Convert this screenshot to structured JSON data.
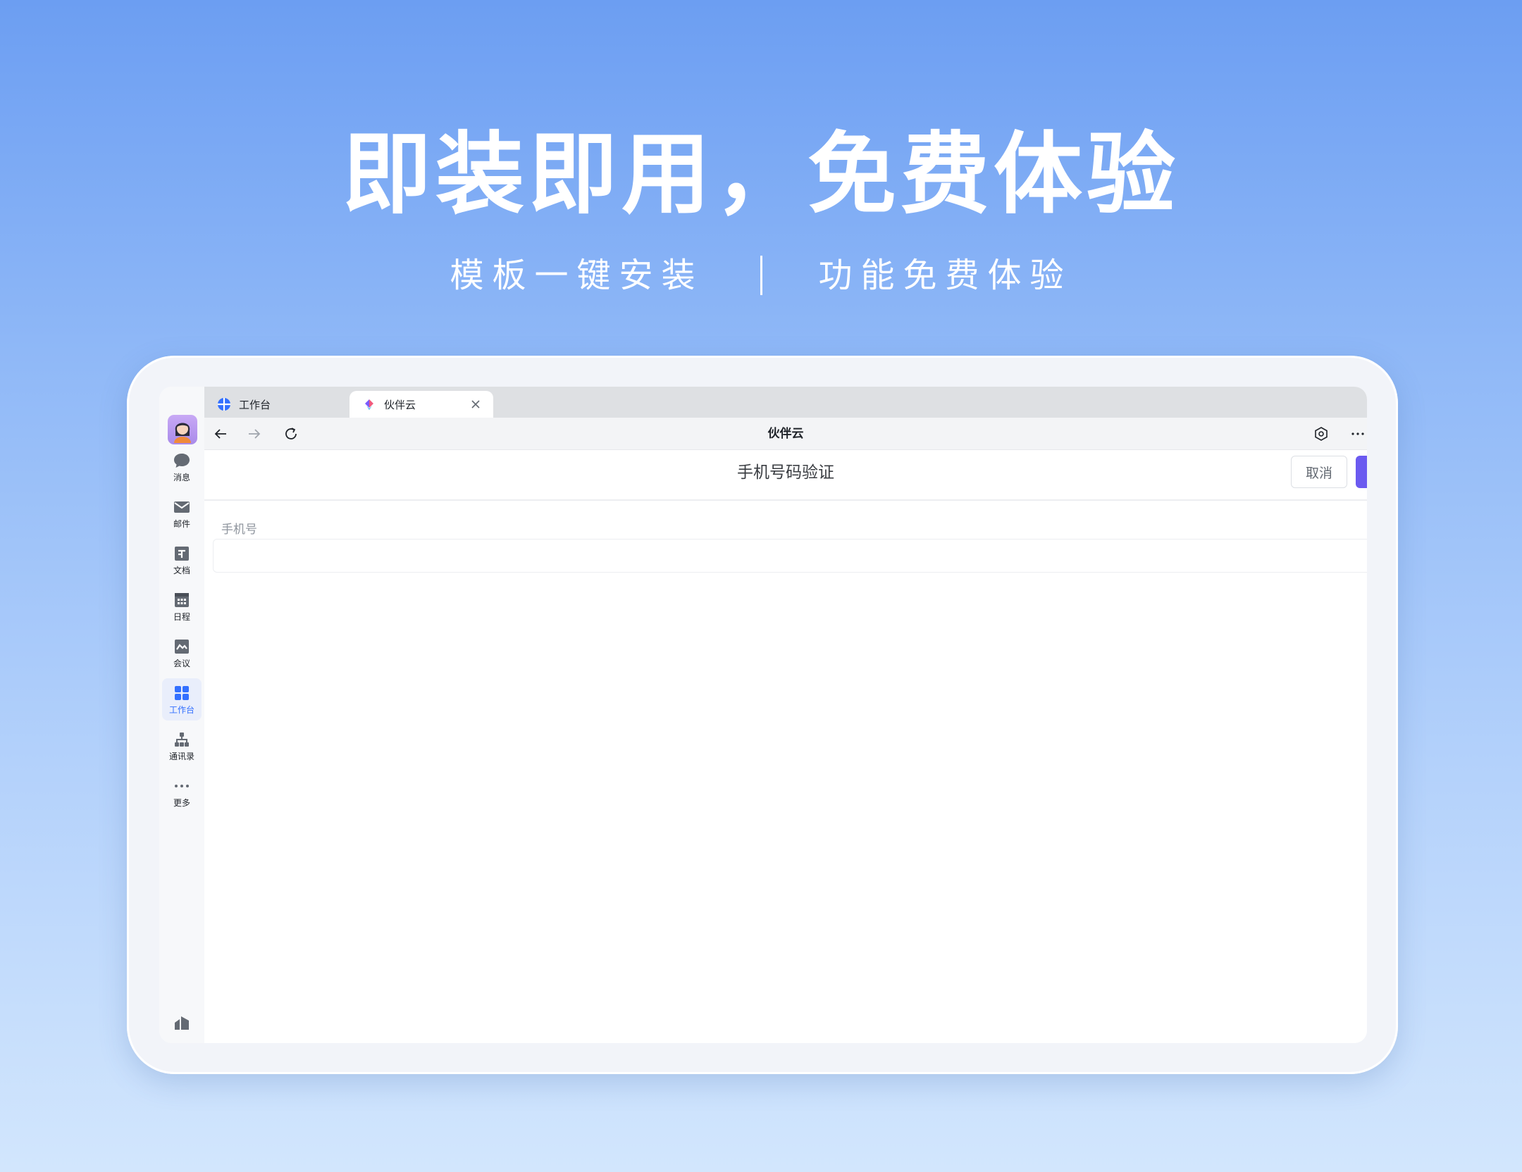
{
  "hero": {
    "title": "即装即用，免费体验",
    "subtitle_left": "模板一键安装",
    "subtitle_right": "功能免费体验"
  },
  "sidebar": {
    "items": [
      {
        "label": "消息",
        "icon": "chat-bubble-icon"
      },
      {
        "label": "邮件",
        "icon": "mail-icon"
      },
      {
        "label": "文档",
        "icon": "document-icon"
      },
      {
        "label": "日程",
        "icon": "calendar-icon"
      },
      {
        "label": "会议",
        "icon": "meeting-icon"
      },
      {
        "label": "工作台",
        "icon": "workspace-grid-icon",
        "active": true
      },
      {
        "label": "通讯录",
        "icon": "org-chart-icon"
      },
      {
        "label": "更多",
        "icon": "more-dots-icon"
      }
    ]
  },
  "tabs": [
    {
      "label": "工作台",
      "icon": "workspace-logo-icon"
    },
    {
      "label": "伙伴云",
      "icon": "huobanyun-logo-icon",
      "active": true
    }
  ],
  "toolbar": {
    "title": "伙伴云"
  },
  "page": {
    "title": "手机号码验证",
    "cancel_label": "取消",
    "phone_label": "手机号",
    "phone_value": ""
  },
  "colors": {
    "accent": "#3370ff",
    "confirm": "#6b5af0",
    "bg_top": "#6c9ef2",
    "bg_bottom": "#d2e6fd"
  }
}
